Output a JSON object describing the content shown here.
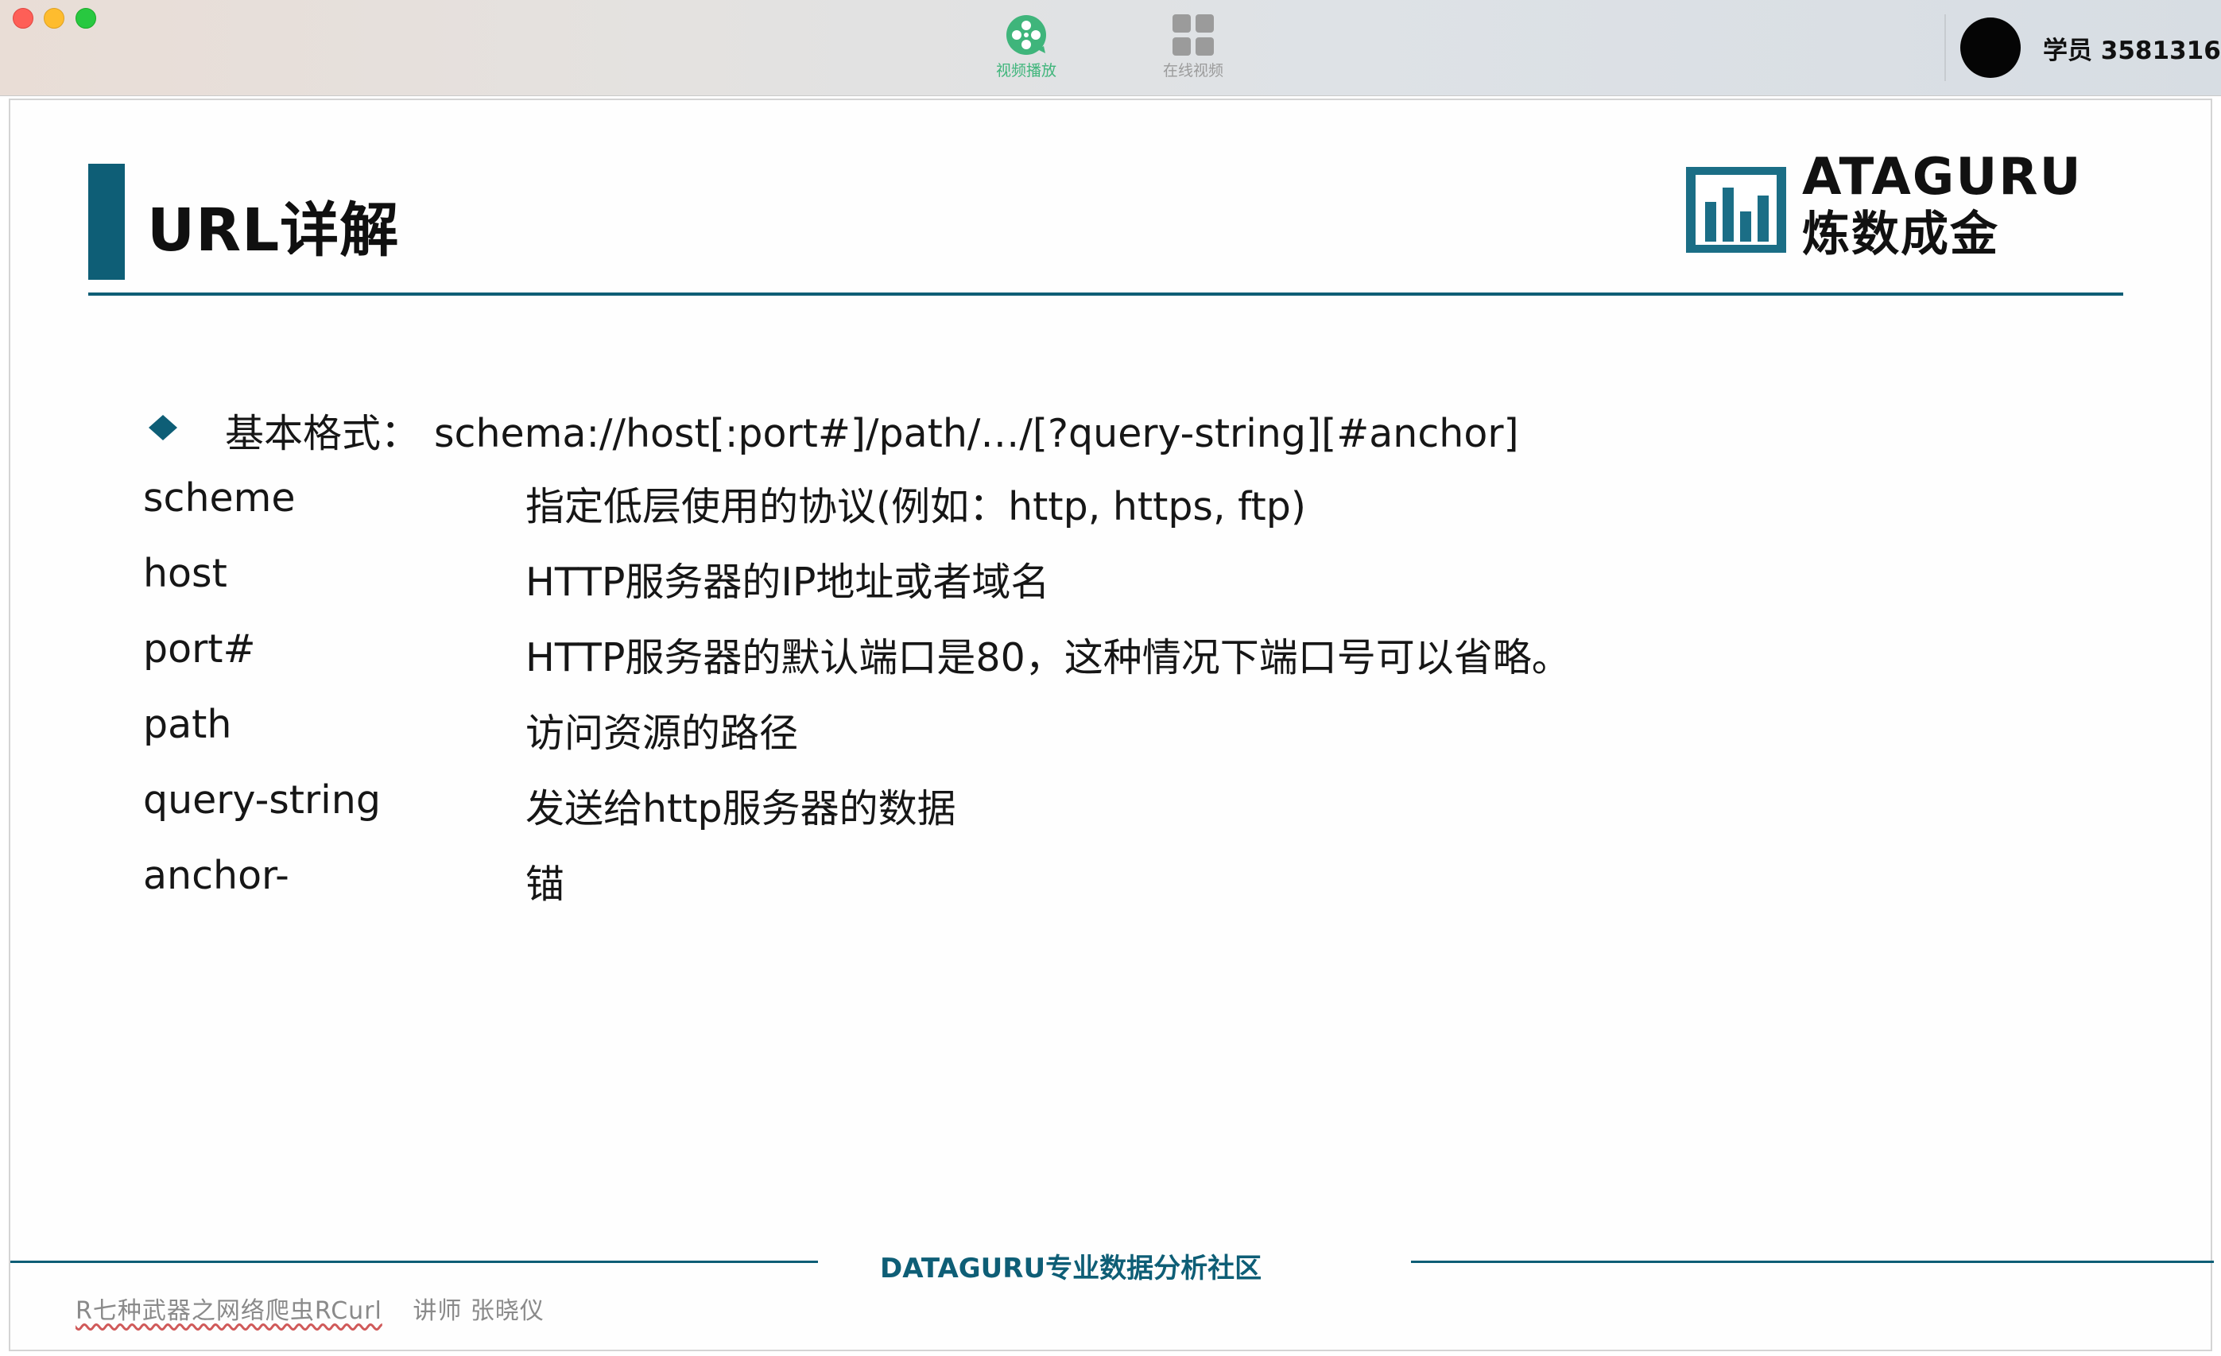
{
  "window": {
    "tabs": [
      {
        "label": "视频播放",
        "icon": "film-reel-icon",
        "active": true,
        "color": "#3fb57b"
      },
      {
        "label": "在线视频",
        "icon": "grid-icon",
        "active": false,
        "color": "#9b9b9b"
      }
    ],
    "user": {
      "name": "学员 3581316",
      "avatar": "avatar"
    }
  },
  "slide": {
    "title": "URL详解",
    "logo": {
      "en": "ATAGURU",
      "cn": "炼数成金"
    },
    "format": {
      "label": "基本格式：",
      "value": "schema://host[:port#]/path/…/[?query-string][#anchor]"
    },
    "rows": [
      {
        "term": "scheme",
        "desc": "指定低层使用的协议(例如：http, https, ftp)"
      },
      {
        "term": "host",
        "desc": "HTTP服务器的IP地址或者域名"
      },
      {
        "term": "port#",
        "desc": "HTTP服务器的默认端口是80，这种情况下端口号可以省略。"
      },
      {
        "term": "path",
        "desc": "访问资源的路径"
      },
      {
        "term": "query-string",
        "desc": "发送给http服务器的数据"
      },
      {
        "term": "anchor-",
        "desc": "锚"
      }
    ],
    "footer": {
      "center": "DATAGURU专业数据分析社区",
      "course": "R七种武器之网络爬虫RCurl",
      "lecturer": "讲师 张晓仪"
    },
    "accent_color": "#0e5e76"
  }
}
